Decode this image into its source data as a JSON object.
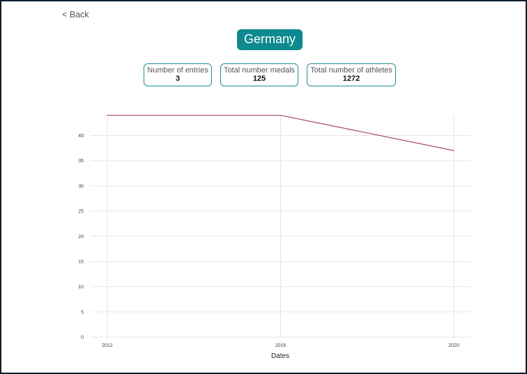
{
  "nav": {
    "back_label": "< Back"
  },
  "header": {
    "title": "Germany"
  },
  "stats": [
    {
      "label": "Number of entries",
      "value": "3"
    },
    {
      "label": "Total number medals",
      "value": "125"
    },
    {
      "label": "Total number of athletes",
      "value": "1272"
    }
  ],
  "colors": {
    "accent": "#0d8a8f",
    "card_border": "#1d8f94",
    "line": "#a0465e",
    "grid": "#e6e6e6"
  },
  "chart_data": {
    "type": "line",
    "title": "",
    "xlabel": "Dates",
    "ylabel": "",
    "x": [
      2012,
      2016,
      2020
    ],
    "x_ticks": [
      "2012",
      "2016",
      "2020"
    ],
    "y_ticks": [
      "0",
      "5",
      "10",
      "15",
      "20",
      "25",
      "30",
      "35",
      "40"
    ],
    "ylim": [
      0,
      44
    ],
    "grid": true,
    "series": [
      {
        "values": [
          44,
          44,
          37
        ]
      }
    ]
  }
}
